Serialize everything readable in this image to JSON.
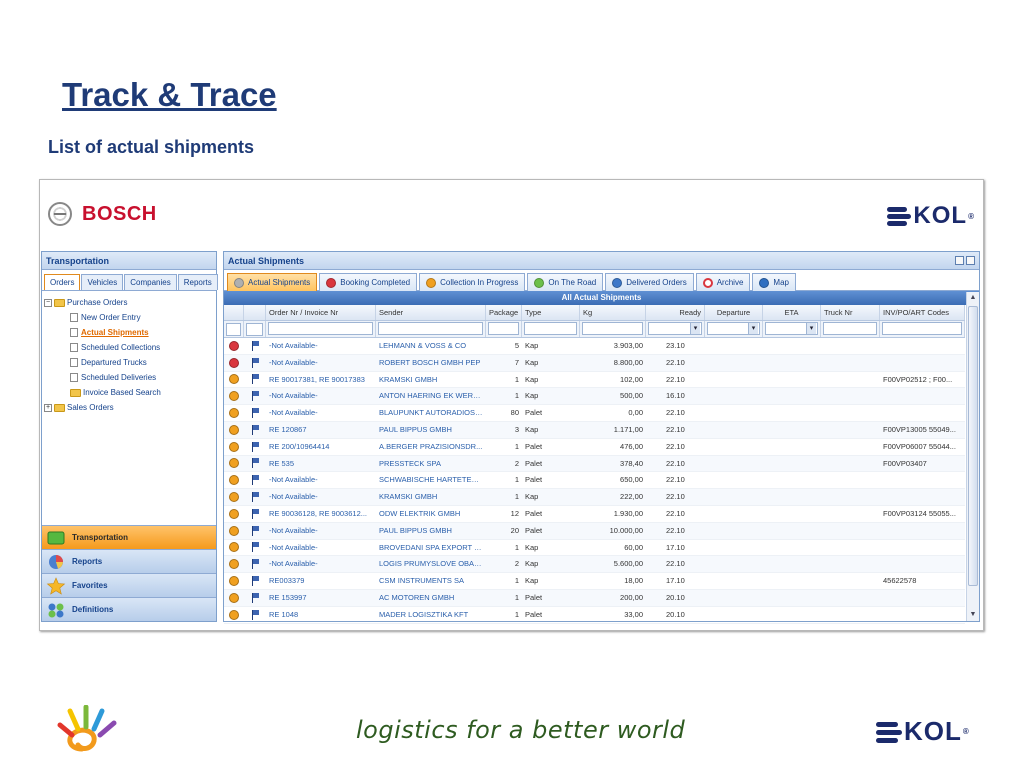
{
  "slide": {
    "title": "Track & Trace",
    "subtitle": "List of actual shipments",
    "tagline": "logistics for a better world",
    "footer_logo": "KOL",
    "footer_logo_reg": "®"
  },
  "app": {
    "client_logo": "BOSCH",
    "vendor_logo": "KOL",
    "vendor_logo_reg": "®",
    "left_panel": {
      "title": "Transportation",
      "tabs": [
        {
          "label": "Orders",
          "active": true
        },
        {
          "label": "Vehicles",
          "active": false
        },
        {
          "label": "Companies",
          "active": false
        },
        {
          "label": "Reports",
          "active": false
        }
      ],
      "tree": {
        "purchase_orders": "Purchase Orders",
        "new_order_entry": "New Order Entry",
        "actual_shipments": "Actual Shipments",
        "scheduled_collections": "Scheduled Collections",
        "departured_trucks": "Departured Trucks",
        "scheduled_deliveries": "Scheduled Deliveries",
        "invoice_based_search": "Invoice Based Search",
        "sales_orders": "Sales Orders"
      },
      "nav": {
        "transportation": "Transportation",
        "reports": "Reports",
        "favorites": "Favorites",
        "definitions": "Definitions"
      }
    },
    "right_panel": {
      "title": "Actual Shipments",
      "status_tabs": [
        {
          "label": "Actual Shipments",
          "color": "#b0b0b0",
          "active": true
        },
        {
          "label": "Booking Completed",
          "color": "#d9363e",
          "active": false
        },
        {
          "label": "Collection In Progress",
          "color": "#f0a020",
          "active": false
        },
        {
          "label": "On The Road",
          "color": "#6cc04a",
          "active": false
        },
        {
          "label": "Delivered Orders",
          "color": "#3d78c9",
          "active": false
        },
        {
          "label": "Archive",
          "color": "#ffffff",
          "active": false
        },
        {
          "label": "Map",
          "color": "#2f6fc1",
          "active": false
        }
      ],
      "grid_caption": "All Actual Shipments",
      "columns": {
        "order": "Order Nr / Invoice Nr",
        "sender": "Sender",
        "package": "Package",
        "type": "Type",
        "kg": "Kg",
        "ready": "Ready",
        "departure": "Departure",
        "eta": "ETA",
        "truck": "Truck Nr",
        "inv": "INV/PO/ART Codes"
      },
      "status_colors": {
        "red": "#d9363e",
        "orange": "#f0a020"
      },
      "rows": [
        {
          "status": "red",
          "order": "-Not Available-",
          "sender": "LEHMANN & VOSS & CO",
          "package": "5",
          "type": "Kap",
          "kg": "3.903,00",
          "ready": "23.10",
          "inv": ""
        },
        {
          "status": "red",
          "order": "-Not Available-",
          "sender": "ROBERT BOSCH GMBH PEP",
          "package": "7",
          "type": "Kap",
          "kg": "8.800,00",
          "ready": "22.10",
          "inv": ""
        },
        {
          "status": "orange",
          "order": "RE 90017381, RE 90017383",
          "sender": "KRAMSKI GMBH",
          "package": "1",
          "type": "Kap",
          "kg": "102,00",
          "ready": "22.10",
          "inv": "F00VP02512 ; F00..."
        },
        {
          "status": "orange",
          "order": "-Not Available-",
          "sender": "ANTON HAERING EK WERK...",
          "package": "1",
          "type": "Kap",
          "kg": "500,00",
          "ready": "16.10",
          "inv": ""
        },
        {
          "status": "orange",
          "order": "-Not Available-",
          "sender": "BLAUPUNKT AUTORADIOS ...",
          "package": "80",
          "type": "Palet",
          "kg": "0,00",
          "ready": "22.10",
          "inv": ""
        },
        {
          "status": "orange",
          "order": "RE 120867",
          "sender": "PAUL BIPPUS GMBH",
          "package": "3",
          "type": "Kap",
          "kg": "1.171,00",
          "ready": "22.10",
          "inv": "F00VP13005 55049..."
        },
        {
          "status": "orange",
          "order": "RE 200/10964414",
          "sender": "A.BERGER PRAZISIONSDR...",
          "package": "1",
          "type": "Palet",
          "kg": "476,00",
          "ready": "22.10",
          "inv": "F00VP06007 55044..."
        },
        {
          "status": "orange",
          "order": "RE 535",
          "sender": "PRESSTECK SPA",
          "package": "2",
          "type": "Palet",
          "kg": "378,40",
          "ready": "22.10",
          "inv": "F00VP03407"
        },
        {
          "status": "orange",
          "order": "-Not Available-",
          "sender": "SCHWABISCHE HARTETEC...",
          "package": "1",
          "type": "Palet",
          "kg": "650,00",
          "ready": "22.10",
          "inv": ""
        },
        {
          "status": "orange",
          "order": "-Not Available-",
          "sender": "KRAMSKI GMBH",
          "package": "1",
          "type": "Kap",
          "kg": "222,00",
          "ready": "22.10",
          "inv": ""
        },
        {
          "status": "orange",
          "order": "RE 90036128, RE 9003612...",
          "sender": "ODW ELEKTRIK GMBH",
          "package": "12",
          "type": "Palet",
          "kg": "1.930,00",
          "ready": "22.10",
          "inv": "F00VP03124 55055..."
        },
        {
          "status": "orange",
          "order": "-Not Available-",
          "sender": "PAUL BIPPUS GMBH",
          "package": "20",
          "type": "Palet",
          "kg": "10.000,00",
          "ready": "22.10",
          "inv": ""
        },
        {
          "status": "orange",
          "order": "-Not Available-",
          "sender": "BROVEDANI SPA EXPORT D...",
          "package": "1",
          "type": "Kap",
          "kg": "60,00",
          "ready": "17.10",
          "inv": ""
        },
        {
          "status": "orange",
          "order": "-Not Available-",
          "sender": "LOGIS PRUMYSLOVE OBAL...",
          "package": "2",
          "type": "Kap",
          "kg": "5.600,00",
          "ready": "22.10",
          "inv": ""
        },
        {
          "status": "orange",
          "order": "RE003379",
          "sender": "CSM INSTRUMENTS SA",
          "package": "1",
          "type": "Kap",
          "kg": "18,00",
          "ready": "17.10",
          "inv": "45622578"
        },
        {
          "status": "orange",
          "order": "RE 153997",
          "sender": "AC MOTOREN GMBH",
          "package": "1",
          "type": "Palet",
          "kg": "200,00",
          "ready": "20.10",
          "inv": ""
        },
        {
          "status": "orange",
          "order": "RE 1048",
          "sender": "MADER LOGISZTIKA KFT",
          "package": "1",
          "type": "Palet",
          "kg": "33,00",
          "ready": "20.10",
          "inv": ""
        }
      ]
    }
  }
}
